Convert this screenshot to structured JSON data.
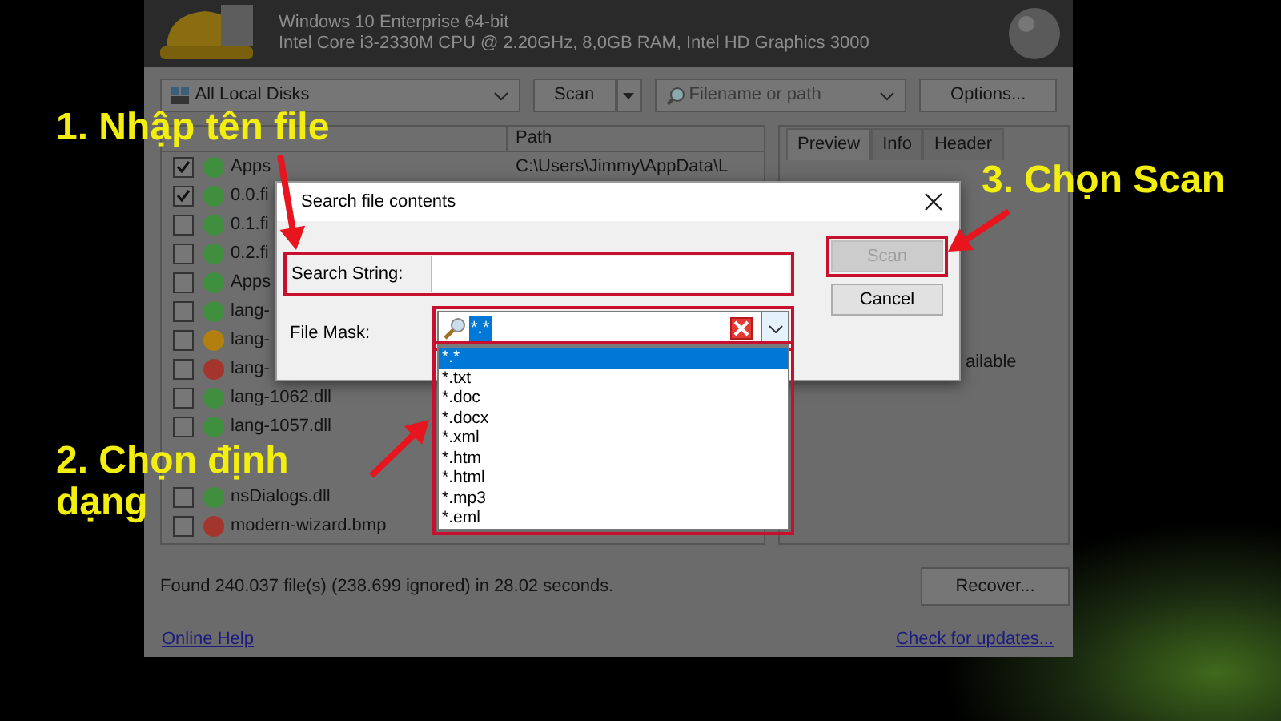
{
  "system_info": {
    "os": "Windows 10 Enterprise 64-bit",
    "hardware": "Intel Core i3-2330M CPU @ 2.20GHz, 8,0GB RAM, Intel HD Graphics 3000"
  },
  "toolbar": {
    "drive": "All Local Disks",
    "scan_button": "Scan",
    "search": {
      "placeholder": "Filename or path"
    },
    "options_button": "Options..."
  },
  "file_list": {
    "columns": [
      "Path"
    ],
    "rows": [
      {
        "name": "Apps",
        "checked": true,
        "color": "#3f8f3f",
        "path": "C:\\Users\\Jimmy\\AppData\\L"
      },
      {
        "name": "0.0.fi",
        "checked": true,
        "color": "#3f8f3f"
      },
      {
        "name": "0.1.fi",
        "checked": false,
        "color": "#3f8f3f"
      },
      {
        "name": "0.2.fi",
        "checked": false,
        "color": "#3f8f3f"
      },
      {
        "name": "Apps",
        "checked": false,
        "color": "#3f8f3f"
      },
      {
        "name": "lang-",
        "checked": false,
        "color": "#3f8f3f"
      },
      {
        "name": "lang-",
        "checked": false,
        "color": "#b3800f"
      },
      {
        "name": "lang-",
        "checked": false,
        "color": "#a3352d"
      },
      {
        "name": "lang-1062.dll",
        "checked": false,
        "color": "#3f8f3f"
      },
      {
        "name": "lang-1057.dll",
        "checked": false,
        "color": "#3f8f3f"
      },
      {
        "name": "nsDialogs.dll",
        "checked": false,
        "color": "#3f8f3f"
      },
      {
        "name": "modern-wizard.bmp",
        "checked": false,
        "color": "#a3352d"
      }
    ]
  },
  "preview": {
    "tabs": [
      {
        "label": "Preview",
        "selected": true
      },
      {
        "label": "Info",
        "selected": false
      },
      {
        "label": "Header",
        "selected": false
      }
    ],
    "text": "ailable"
  },
  "status": "Found 240.037 file(s) (238.699 ignored) in 28.02 seconds.",
  "recover_button": "Recover...",
  "links": [
    "Online Help",
    "Check for updates..."
  ],
  "dialog": {
    "title": "Search file contents",
    "search_label": "Search String:",
    "file_mask_label": "File Mask:",
    "file_mask_value": "*.*",
    "options": [
      {
        "label": "*.*",
        "selected": true
      },
      {
        "label": "*.txt",
        "selected": false
      },
      {
        "label": "*.doc",
        "selected": false
      },
      {
        "label": "*.docx",
        "selected": false
      },
      {
        "label": "*.xml",
        "selected": false
      },
      {
        "label": "*.htm",
        "selected": false
      },
      {
        "label": "*.html",
        "selected": false
      },
      {
        "label": "*.mp3",
        "selected": false
      },
      {
        "label": "*.eml",
        "selected": false
      }
    ],
    "scan_button": {
      "label": "Scan",
      "disabled": true
    },
    "cancel_button": "Cancel"
  },
  "annotations": [
    {
      "lines": [
        "1. Nhập tên file"
      ]
    },
    {
      "lines": [
        "2. Chọn định",
        "dạng"
      ]
    },
    {
      "lines": [
        "3. Chọn Scan"
      ]
    }
  ]
}
